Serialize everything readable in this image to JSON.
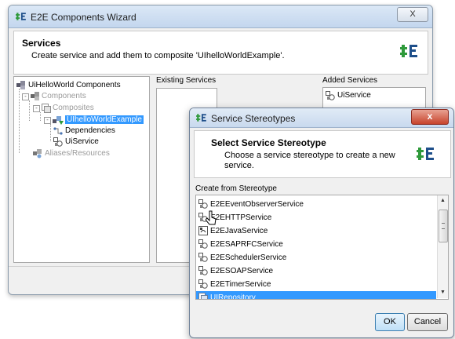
{
  "wizard": {
    "title": "E2E Components Wizard",
    "close_label": "X",
    "header_title": "Services",
    "header_desc": "Create service and add them to composite 'UIhelloWorldExample'.",
    "tree": {
      "root": "UiHelloWorld Components",
      "components": "Components",
      "composites": "Composites",
      "selected": "UIhelloWorldExample",
      "dependencies": "Dependencies",
      "uiservice": "UiService",
      "aliases": "Aliases/Resources"
    },
    "existing_label": "Existing Services",
    "added_label": "Added Services",
    "added_items": [
      "UiService"
    ]
  },
  "dialog": {
    "title": "Service Stereotypes",
    "close_label": "x",
    "header_title": "Select Service Stereotype",
    "header_desc": "Choose a service stereotype to create a new service.",
    "list_label": "Create from Stereotype",
    "items": [
      {
        "label": "E2EEventObserverService",
        "icon": "service-icon"
      },
      {
        "label": "E2EHTTPService",
        "icon": "service-icon"
      },
      {
        "label": "E2EJavaService",
        "icon": "java-service-icon"
      },
      {
        "label": "E2ESAPRFCService",
        "icon": "service-icon"
      },
      {
        "label": "E2ESchedulerService",
        "icon": "service-icon"
      },
      {
        "label": "E2ESOAPService",
        "icon": "service-icon"
      },
      {
        "label": "E2ETimerService",
        "icon": "service-icon"
      },
      {
        "label": "UIRepository",
        "icon": "repository-icon",
        "selected": true
      }
    ],
    "ok_label": "OK",
    "cancel_label": "Cancel"
  },
  "colors": {
    "selection": "#3399ff",
    "logo_green": "#2f9a3b",
    "logo_blue": "#1e4f8a"
  }
}
